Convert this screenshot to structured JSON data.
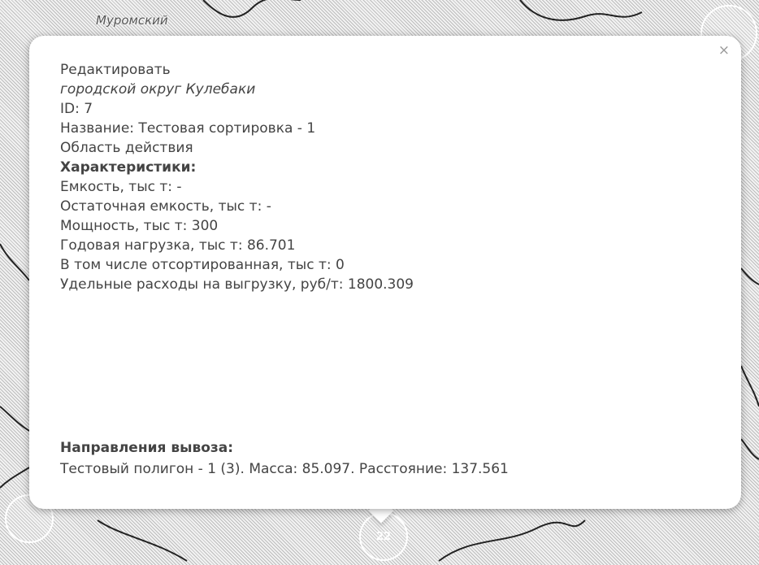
{
  "map": {
    "district_label": "Муромский",
    "marker_center_label": "22"
  },
  "popup": {
    "close_label": "×",
    "title": "Редактировать",
    "subtitle": "городской округ Кулебаки",
    "id_line": "ID: 7",
    "name_line": "Название: Тестовая сортировка - 1",
    "area_line": "Область действия",
    "characteristics_heading": "Характеристики:",
    "characteristics": [
      "Емкость, тыс т: -",
      "Остаточная емкость, тыс т: -",
      "Мощность, тыс т: 300",
      "Годовая нагрузка, тыс т: 86.701",
      "В том числе отсортированная, тыс т: 0",
      "Удельные расходы на выгрузку, руб/т: 1800.309"
    ],
    "directions_heading": "Направления вывоза:",
    "directions_line": "Тестовый полигон - 1 (3). Масса: 85.097. Расстояние: 137.561"
  }
}
